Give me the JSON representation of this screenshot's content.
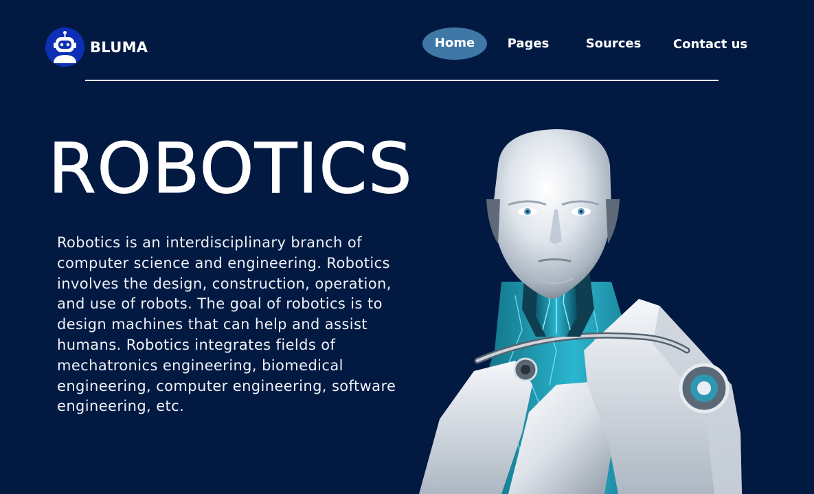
{
  "brand": {
    "name": "BLUMA",
    "icon": "robot-head-icon"
  },
  "nav": {
    "items": [
      {
        "label": "Home",
        "active": true
      },
      {
        "label": "Pages",
        "active": false
      },
      {
        "label": "Sources",
        "active": false
      },
      {
        "label": "Contact us",
        "active": false
      }
    ]
  },
  "hero": {
    "title": "ROBOTICS",
    "body": "Robotics is an interdisciplinary branch of computer science and engineering. Robotics involves the design, construction, operation, and use of robots. The goal of robotics is to design machines that can help and assist humans. Robotics integrates fields of mechatronics engineering, biomedical engineering, computer engineering, software engineering, etc.",
    "image": "humanoid-robot-illustration"
  },
  "colors": {
    "background": "#021a42",
    "nav_active": "#3f77a6",
    "logo_circle": "#0d2fb5",
    "text": "#ffffff"
  }
}
